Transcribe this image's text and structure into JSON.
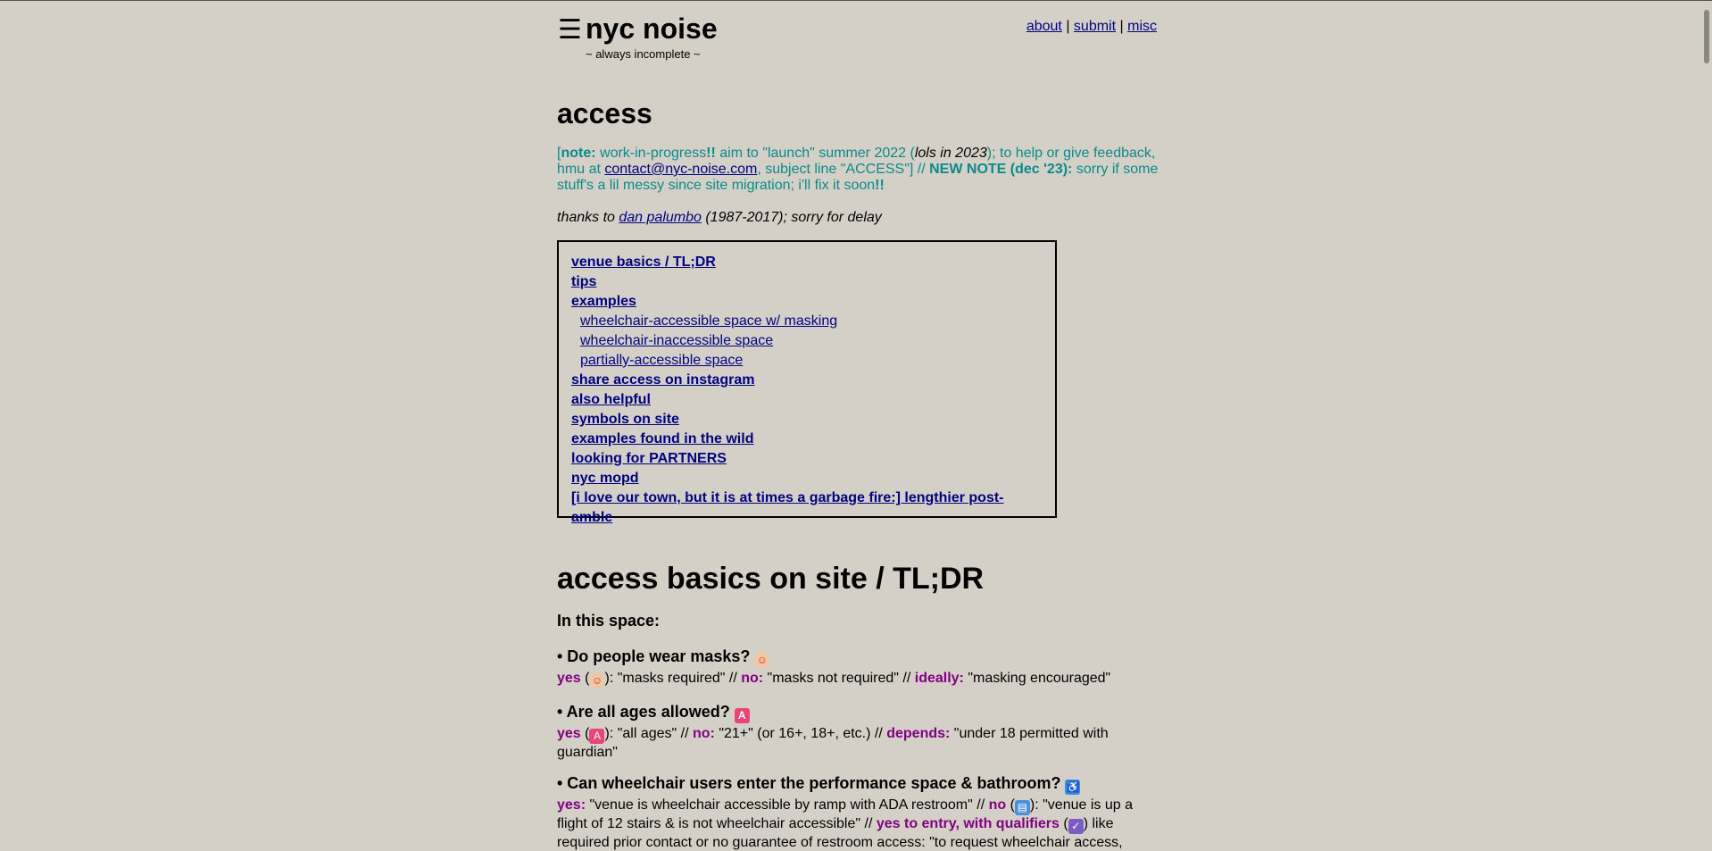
{
  "header": {
    "menu_glyph": "☰",
    "site_title": "nyc noise",
    "tagline": "~ always incomplete ~",
    "nav": [
      {
        "label": "about"
      },
      {
        "label": "submit"
      },
      {
        "label": "misc"
      }
    ],
    "nav_sep": "|"
  },
  "page": {
    "title": "access",
    "note": {
      "open": "[",
      "note_label": "note:",
      "text1": " work-in-progress",
      "bang1": "!!",
      "text2": " aim to \"launch\" summer 2022 (",
      "italic": "lols in 2023",
      "text3": "); to help or give feedback, hmu at ",
      "email": "contact@nyc-noise.com",
      "text4": ", subject line \"ACCESS\"] // ",
      "new_note": "NEW NOTE (dec '23):",
      "text5": " sorry if some stuff's a lil messy since site migration; i'll fix it soon",
      "bang2": "!!"
    },
    "thanks": {
      "pre": "thanks to ",
      "link": "dan palumbo",
      "post": " (1987-2017); sorry for delay"
    }
  },
  "toc": [
    {
      "label": "venue basics / TL;DR",
      "level": "main"
    },
    {
      "label": "tips",
      "level": "main"
    },
    {
      "label": "examples",
      "level": "main"
    },
    {
      "label": "wheelchair-accessible space w/ masking",
      "level": "sub"
    },
    {
      "label": "wheelchair-inaccessible space",
      "level": "sub"
    },
    {
      "label": "partially-accessible space",
      "level": "sub"
    },
    {
      "label": "share access on instagram",
      "level": "main"
    },
    {
      "label": "also helpful",
      "level": "main"
    },
    {
      "label": "symbols on site",
      "level": "main"
    },
    {
      "label": "examples found in the wild",
      "level": "main"
    },
    {
      "label": "looking for PARTNERS",
      "level": "main"
    },
    {
      "label": "nyc mopd",
      "level": "main"
    },
    {
      "label": "[i love our town, but it is at times a garbage fire:] lengthier post-amble",
      "level": "main"
    }
  ],
  "basics": {
    "title": "access basics on site / TL;DR",
    "intro": "In this space:",
    "q1": {
      "question": "• Do people wear masks?",
      "icon": "mask-icon",
      "yes": "yes",
      "yes_text": "): \"masks required\" // ",
      "no": "no:",
      "no_text": " \"masks not required\" // ",
      "ideally": "ideally:",
      "ideally_text": " \"masking encouraged\""
    },
    "q2": {
      "question": "• Are all ages allowed?",
      "icon": "all-ages-icon",
      "yes": "yes",
      "yes_text": "): \"all ages\" // ",
      "no": "no:",
      "no_text": " \"21+\" (or 16+, 18+, etc.) // ",
      "depends": "depends:",
      "depends_text": " \"under 18 permitted with guardian\""
    },
    "q3": {
      "question": "• Can wheelchair users enter the performance space & bathroom?",
      "icon": "wheelchair-icon",
      "yes": "yes:",
      "yes_text": " \"venue is wheelchair accessible by ramp with ADA restroom\" // ",
      "no": "no",
      "no_text": "): \"venue is up a flight of 12 stairs & is not wheelchair accessible\" // ",
      "qualified": "yes to entry, with qualifiers",
      "qualified_text": ") like required prior contact or no guarantee of restroom access: \"to request wheelchair access,"
    }
  },
  "colors": {
    "background": "#d4d0c8",
    "link": "#000080",
    "note_teal": "#0a8a8a",
    "answer_purple": "#800080"
  }
}
